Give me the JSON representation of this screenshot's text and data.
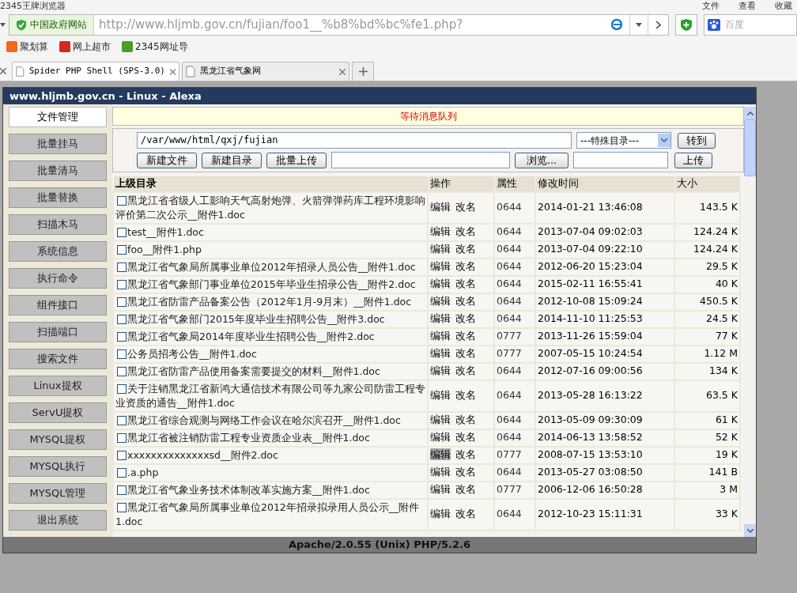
{
  "browser": {
    "title": "2345王牌浏览器",
    "menu": [
      "文件",
      "查看",
      "收藏"
    ],
    "site_badge": "中国政府网站",
    "url": "http://www.hljmb.gov.cn/fujian/foo1__%b8%bd%bc%fe1.php?",
    "search_placeholder": "百度",
    "bookmarks": [
      "聚划算",
      "网上超市",
      "2345网址导"
    ],
    "tabs": [
      {
        "label": "Spider PHP Shell (SPS-3.0)",
        "selected": true
      },
      {
        "label": "黑龙江省气象网",
        "selected": false
      }
    ]
  },
  "page": {
    "title": "www.hljmb.gov.cn - Linux - Alexa",
    "sidebar": [
      {
        "label": "文件管理",
        "selected": true
      },
      {
        "label": "批量挂马",
        "selected": false
      },
      {
        "label": "批量清马",
        "selected": false
      },
      {
        "label": "批量替换",
        "selected": false
      },
      {
        "label": "扫描木马",
        "selected": false
      },
      {
        "label": "系统信息",
        "selected": false
      },
      {
        "label": "执行命令",
        "selected": false
      },
      {
        "label": "组件接口",
        "selected": false
      },
      {
        "label": "扫描端口",
        "selected": false
      },
      {
        "label": "搜索文件",
        "selected": false
      },
      {
        "label": "Linux提权",
        "selected": false
      },
      {
        "label": "ServU提权",
        "selected": false
      },
      {
        "label": "MYSQL提权",
        "selected": false
      },
      {
        "label": "MYSQL执行",
        "selected": false
      },
      {
        "label": "MYSQL管理",
        "selected": false
      },
      {
        "label": "退出系统",
        "selected": false
      }
    ],
    "message": "等待消息队列",
    "path": "/var/www/html/qxj/fujian",
    "special_dir": "---特殊目录---",
    "goto_button": "转到",
    "buttons": [
      "新建文件",
      "新建目录",
      "批量上传"
    ],
    "browse_button": "浏览...",
    "upload_button": "上传",
    "columns": [
      "上级目录",
      "操作",
      "属性",
      "修改时间",
      "大小"
    ],
    "rows": [
      {
        "checked": false,
        "name": "黑龙江省省级人工影响天气高射炮弹、火箭弹弹药库工程环境影响评价第二次公示__附件1.doc",
        "edit": "编辑",
        "rename": "改名",
        "edit_hovered": false,
        "perm": "0644",
        "time": "2014-01-21 13:46:08",
        "size": "143.5 K"
      },
      {
        "checked": false,
        "name": "test__附件1.doc",
        "edit": "编辑",
        "rename": "改名",
        "edit_hovered": false,
        "perm": "0644",
        "time": "2013-07-04 09:02:03",
        "size": "124.24 K"
      },
      {
        "checked": false,
        "name": "foo__附件1.php",
        "edit": "编辑",
        "rename": "改名",
        "edit_hovered": false,
        "perm": "0644",
        "time": "2013-07-04 09:22:10",
        "size": "124.24 K"
      },
      {
        "checked": false,
        "name": "黑龙江省气象局所属事业单位2012年招录人员公告__附件1.doc",
        "edit": "编辑",
        "rename": "改名",
        "edit_hovered": false,
        "perm": "0644",
        "time": "2012-06-20 15:23:04",
        "size": "29.5 K"
      },
      {
        "checked": false,
        "name": "黑龙江省气象部门事业单位2015年毕业生招录公告__附件2.doc",
        "edit": "编辑",
        "rename": "改名",
        "edit_hovered": false,
        "perm": "0644",
        "time": "2015-02-11 16:55:41",
        "size": "40 K"
      },
      {
        "checked": false,
        "name": "黑龙江省防雷产品备案公告（2012年1月-9月末）__附件1.doc",
        "edit": "编辑",
        "rename": "改名",
        "edit_hovered": false,
        "perm": "0644",
        "time": "2012-10-08 15:09:24",
        "size": "450.5 K"
      },
      {
        "checked": false,
        "name": "黑龙江省气象部门2015年度毕业生招聘公告__附件3.doc",
        "edit": "编辑",
        "rename": "改名",
        "edit_hovered": false,
        "perm": "0644",
        "time": "2014-11-10 11:25:53",
        "size": "24.5 K"
      },
      {
        "checked": false,
        "name": "黑龙江省气象局2014年度毕业生招聘公告__附件2.doc",
        "edit": "编辑",
        "rename": "改名",
        "edit_hovered": false,
        "perm": "0777",
        "time": "2013-11-26 15:59:04",
        "size": "77 K"
      },
      {
        "checked": false,
        "name": "公务员招考公告__附件1.doc",
        "edit": "编辑",
        "rename": "改名",
        "edit_hovered": false,
        "perm": "0777",
        "time": "2007-05-15 10:24:54",
        "size": "1.12 M"
      },
      {
        "checked": false,
        "name": "黑龙江省防雷产品使用备案需要提交的材料__附件1.doc",
        "edit": "编辑",
        "rename": "改名",
        "edit_hovered": false,
        "perm": "0644",
        "time": "2012-07-16 09:00:56",
        "size": "134 K"
      },
      {
        "checked": false,
        "name": "关于注销黑龙江省新鸿大通信技术有限公司等九家公司防雷工程专业资质的通告__附件1.doc",
        "edit": "编辑",
        "rename": "改名",
        "edit_hovered": false,
        "perm": "0644",
        "time": "2013-05-28 16:13:22",
        "size": "63.5 K"
      },
      {
        "checked": false,
        "name": "黑龙江省综合观测与网络工作会议在哈尔滨召开__附件1.doc",
        "edit": "编辑",
        "rename": "改名",
        "edit_hovered": false,
        "perm": "0644",
        "time": "2013-05-09 09:30:09",
        "size": "61 K"
      },
      {
        "checked": false,
        "name": "黑龙江省被注销防雷工程专业资质企业表__附件1.doc",
        "edit": "编辑",
        "rename": "改名",
        "edit_hovered": false,
        "perm": "0644",
        "time": "2014-06-13 13:58:52",
        "size": "52 K"
      },
      {
        "checked": false,
        "name": "xxxxxxxxxxxxxxsd__附件2.doc",
        "edit": "编辑",
        "rename": "改名",
        "edit_hovered": true,
        "perm": "0777",
        "time": "2008-07-15 13:53:10",
        "size": "19 K"
      },
      {
        "checked": false,
        "name": ".a.php",
        "edit": "编辑",
        "rename": "改名",
        "edit_hovered": false,
        "perm": "0644",
        "time": "2013-05-27 03:08:50",
        "size": "141 B"
      },
      {
        "checked": false,
        "name": "黑龙江省气象业务技术体制改革实施方案__附件1.doc",
        "edit": "编辑",
        "rename": "改名",
        "edit_hovered": false,
        "perm": "0777",
        "time": "2006-12-06 16:50:28",
        "size": "3 M"
      },
      {
        "checked": false,
        "name": "黑龙江省气象局所属事业单位2012年招录拟录用人员公示__附件1.doc",
        "edit": "编辑",
        "rename": "改名",
        "edit_hovered": false,
        "perm": "0644",
        "time": "2012-10-23 15:11:31",
        "size": "33 K"
      }
    ],
    "footer": "Apache/2.0.55 (Unix) PHP/5.2.6"
  }
}
